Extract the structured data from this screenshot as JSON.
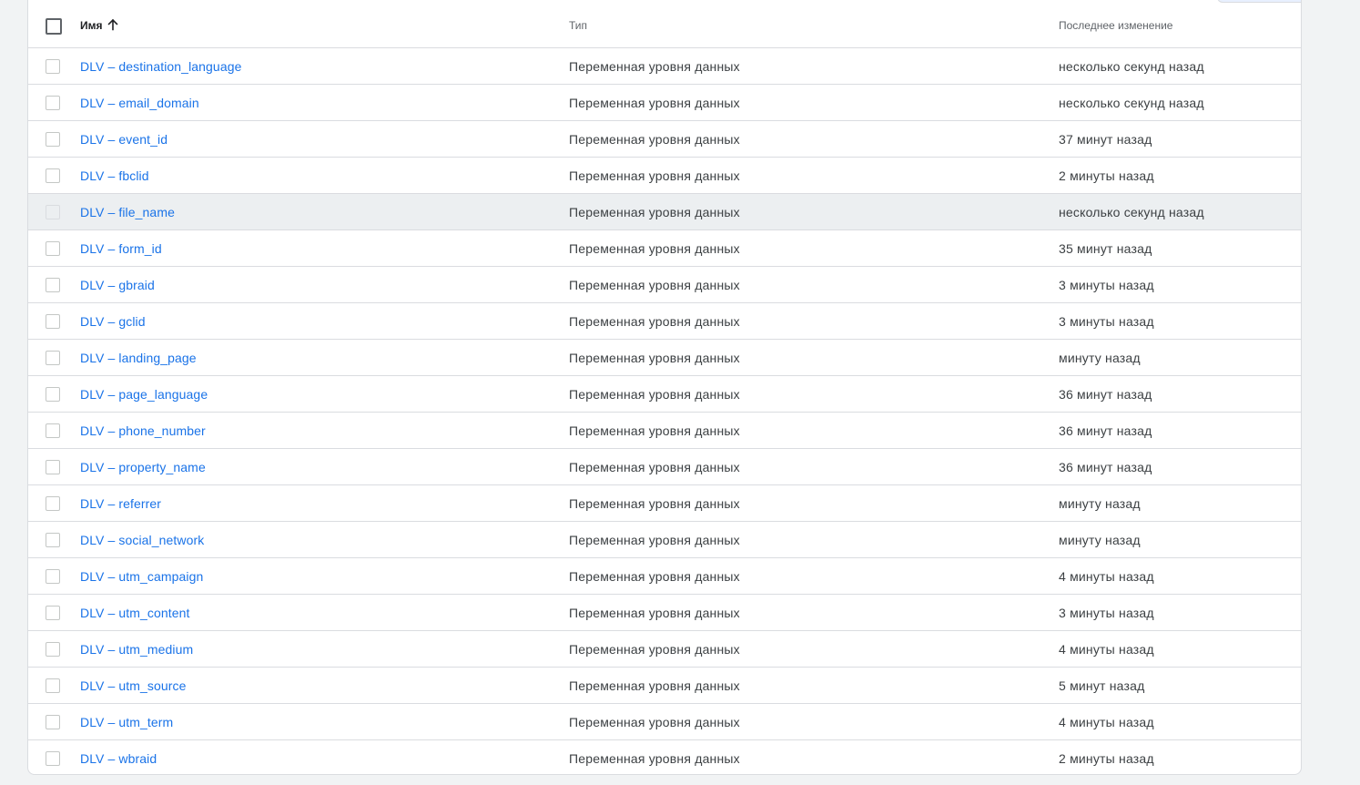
{
  "table": {
    "headers": {
      "name": "Имя",
      "type": "Тип",
      "modified": "Последнее изменение"
    },
    "sort": {
      "column": "name",
      "direction": "ascending",
      "icon": "arrow-up-icon"
    },
    "hover_row": 4,
    "rows": [
      {
        "name": "DLV – destination_language",
        "type": "Переменная уровня данных",
        "modified": "несколько секунд назад"
      },
      {
        "name": "DLV – email_domain",
        "type": "Переменная уровня данных",
        "modified": "несколько секунд назад"
      },
      {
        "name": "DLV – event_id",
        "type": "Переменная уровня данных",
        "modified": "37 минут назад"
      },
      {
        "name": "DLV – fbclid",
        "type": "Переменная уровня данных",
        "modified": "2 минуты назад"
      },
      {
        "name": "DLV – file_name",
        "type": "Переменная уровня данных",
        "modified": "несколько секунд назад"
      },
      {
        "name": "DLV – form_id",
        "type": "Переменная уровня данных",
        "modified": "35 минут назад"
      },
      {
        "name": "DLV – gbraid",
        "type": "Переменная уровня данных",
        "modified": "3 минуты назад"
      },
      {
        "name": "DLV – gclid",
        "type": "Переменная уровня данных",
        "modified": "3 минуты назад"
      },
      {
        "name": "DLV – landing_page",
        "type": "Переменная уровня данных",
        "modified": "минуту назад"
      },
      {
        "name": "DLV – page_language",
        "type": "Переменная уровня данных",
        "modified": "36 минут назад"
      },
      {
        "name": "DLV – phone_number",
        "type": "Переменная уровня данных",
        "modified": "36 минут назад"
      },
      {
        "name": "DLV – property_name",
        "type": "Переменная уровня данных",
        "modified": "36 минут назад"
      },
      {
        "name": "DLV – referrer",
        "type": "Переменная уровня данных",
        "modified": "минуту назад"
      },
      {
        "name": "DLV – social_network",
        "type": "Переменная уровня данных",
        "modified": "минуту назад"
      },
      {
        "name": "DLV – utm_campaign",
        "type": "Переменная уровня данных",
        "modified": "4 минуты назад"
      },
      {
        "name": "DLV – utm_content",
        "type": "Переменная уровня данных",
        "modified": "3 минуты назад"
      },
      {
        "name": "DLV – utm_medium",
        "type": "Переменная уровня данных",
        "modified": "4 минуты назад"
      },
      {
        "name": "DLV – utm_source",
        "type": "Переменная уровня данных",
        "modified": "5 минут назад"
      },
      {
        "name": "DLV – utm_term",
        "type": "Переменная уровня данных",
        "modified": "4 минуты назад"
      },
      {
        "name": "DLV – wbraid",
        "type": "Переменная уровня данных",
        "modified": "2 минуты назад"
      }
    ]
  },
  "colors": {
    "link": "#1a73e8",
    "row_hover": "#eceff1",
    "divider": "#dadce0",
    "page_background": "#f1f3f4"
  }
}
